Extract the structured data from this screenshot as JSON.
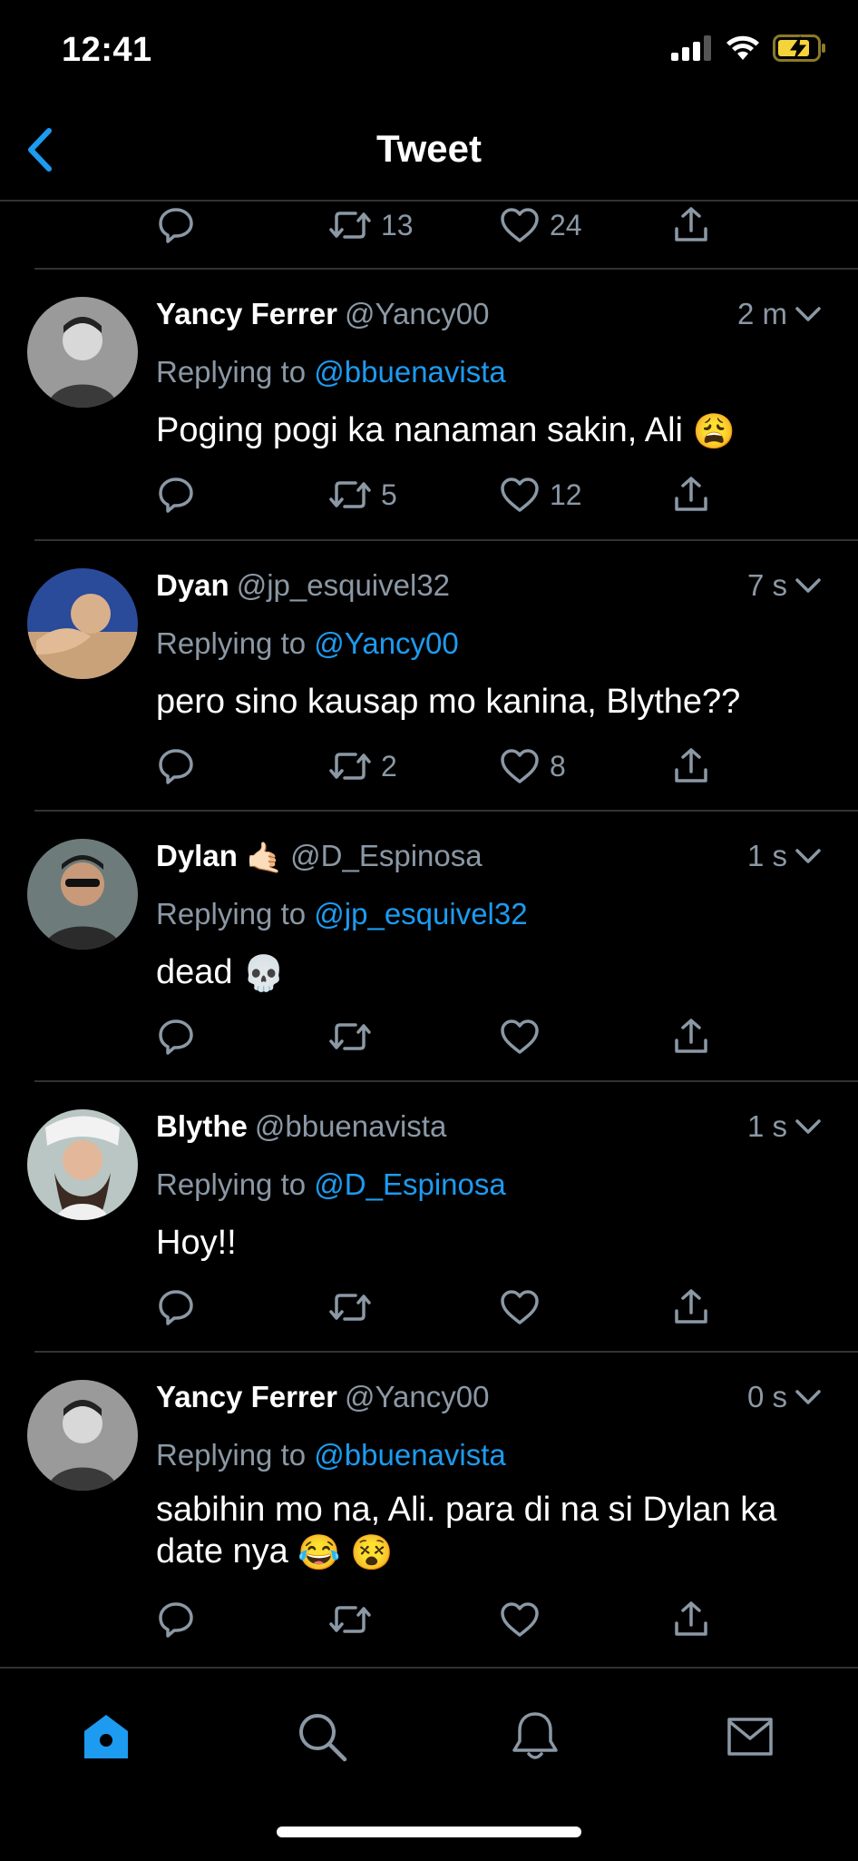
{
  "status_bar": {
    "time": "12:41",
    "battery_icon": "battery-charging-icon",
    "signal_icon": "cellular-signal-icon",
    "wifi_icon": "wifi-icon"
  },
  "nav": {
    "title": "Tweet",
    "back_icon": "chevron-left-icon"
  },
  "colors": {
    "accent": "#1d9bf0",
    "secondary_text": "#8b98a5",
    "divider": "#2f3336",
    "background": "#000000"
  },
  "top_actions": {
    "retweets": "13",
    "likes": "24"
  },
  "replying_to_label": "Replying to",
  "tweets": [
    {
      "name": "Yancy Ferrer",
      "handle": "@Yancy00",
      "time": "2 m",
      "replying_to": "@bbuenavista",
      "text": "Poging pogi ka nanaman sakin, Ali",
      "emoji": "😩",
      "retweets": "5",
      "likes": "12"
    },
    {
      "name": "Dyan",
      "handle": "@jp_esquivel32",
      "time": "7 s",
      "replying_to": "@Yancy00",
      "text": "pero sino kausap mo kanina, Blythe??",
      "retweets": "2",
      "likes": "8"
    },
    {
      "name": "Dylan",
      "name_emoji": "🤙🏻",
      "handle": "@D_Espinosa",
      "time": "1 s",
      "replying_to": "@jp_esquivel32",
      "text": "dead",
      "emoji": "💀",
      "retweets": "",
      "likes": ""
    },
    {
      "name": "Blythe",
      "handle": "@bbuenavista",
      "time": "1 s",
      "replying_to": "@D_Espinosa",
      "text": "Hoy!!",
      "retweets": "",
      "likes": ""
    },
    {
      "name": "Yancy Ferrer",
      "handle": "@Yancy00",
      "time": "0 s",
      "replying_to": "@bbuenavista",
      "text": "sabihin mo na, Ali. para di na si Dylan ka date nya",
      "emoji": "😂 😵",
      "retweets": "",
      "likes": ""
    }
  ],
  "tabbar": {
    "items": [
      "home-icon",
      "search-icon",
      "notifications-icon",
      "messages-icon"
    ]
  }
}
